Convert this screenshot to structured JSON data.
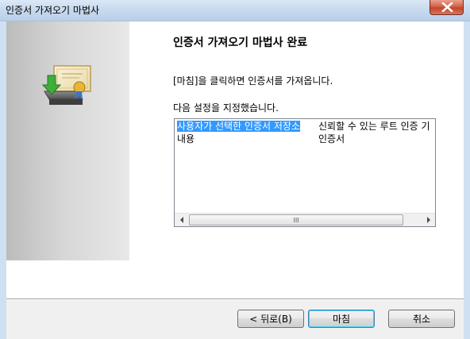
{
  "window": {
    "title": "인증서 가져오기 마법사"
  },
  "heading": "인증서 가져오기 마법사 완료",
  "instruction": "[마침]을 클릭하면 인증서를 가져옵니다.",
  "settings_label": "다음 설정을 지정했습니다.",
  "settings": [
    {
      "name": "사용자가 선택한 인증서 저장소",
      "value": "신뢰할 수 있는 루트 인증 기"
    },
    {
      "name": "내용",
      "value": "인증서"
    }
  ],
  "scrollbar": {
    "thumb_grip": "III"
  },
  "buttons": {
    "back": "< 뒤로(B)",
    "finish": "마침",
    "cancel": "취소"
  },
  "icons": {
    "close": "close-icon",
    "wizard": "certificate-import-icon"
  }
}
